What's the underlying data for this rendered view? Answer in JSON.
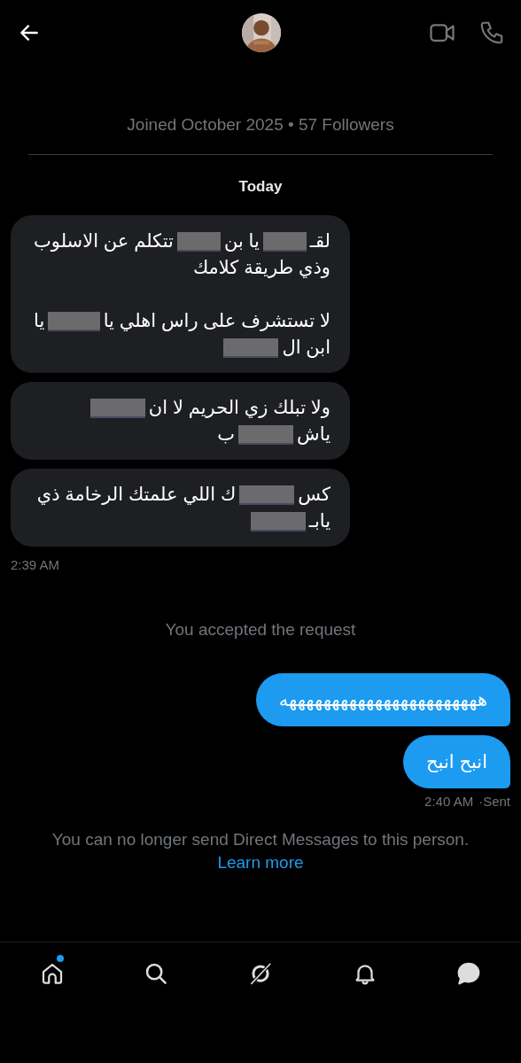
{
  "header": {
    "profile": {
      "joined": "Joined October 2025 • 57 Followers"
    }
  },
  "day_label": "Today",
  "incoming": {
    "messages": [
      {
        "lines": [
          [
            {
              "kind": "text",
              "text": "لقـ"
            },
            {
              "kind": "redaction"
            },
            {
              "kind": "text",
              "text": "يا بن"
            },
            {
              "kind": "redaction"
            },
            {
              "kind": "text",
              "text": "تتكلم عن الاسلوب"
            }
          ],
          [
            {
              "kind": "text",
              "text": "وذي طريقة كلامك"
            }
          ],
          [
            {
              "kind": "paragraph_break"
            },
            {
              "kind": "text",
              "text": "لا تستشرف على راس اهلي يا"
            },
            {
              "kind": "redaction"
            },
            {
              "kind": "text",
              "text": "يا"
            }
          ],
          [
            {
              "kind": "text",
              "text": "ابن ال"
            },
            {
              "kind": "redaction"
            }
          ]
        ]
      },
      {
        "lines": [
          [
            {
              "kind": "text",
              "text": "ولا تبلك زي الحريم لا ان"
            },
            {
              "kind": "redaction"
            }
          ],
          [
            {
              "kind": "text",
              "text": "ياش"
            },
            {
              "kind": "redaction"
            },
            {
              "kind": "text",
              "text": "ب"
            }
          ]
        ]
      },
      {
        "lines": [
          [
            {
              "kind": "text",
              "text": "كس"
            },
            {
              "kind": "redaction"
            },
            {
              "kind": "text",
              "text": "ك اللي علمتك الرخامة ذي"
            }
          ],
          [
            {
              "kind": "text",
              "text": "يابـ"
            },
            {
              "kind": "redaction"
            }
          ]
        ]
      }
    ],
    "time": "2:39 AM"
  },
  "system_note": "You accepted the request",
  "outgoing": {
    "messages": [
      {
        "text": "هههههههههههههههههههههههه"
      },
      {
        "text": "انبح انبح"
      }
    ],
    "time": "2:40 AM",
    "status": "·Sent"
  },
  "notice": {
    "text": "You can no longer send Direct Messages to this person.",
    "link": "Learn more"
  },
  "tab_bar": {
    "items": [
      {
        "kind": "home",
        "selected": false,
        "badge": true
      },
      {
        "kind": "search",
        "selected": false,
        "badge": false
      },
      {
        "kind": "grok",
        "selected": false,
        "badge": false
      },
      {
        "kind": "bell",
        "selected": false,
        "badge": false
      },
      {
        "kind": "messages",
        "selected": true,
        "badge": false
      }
    ]
  }
}
